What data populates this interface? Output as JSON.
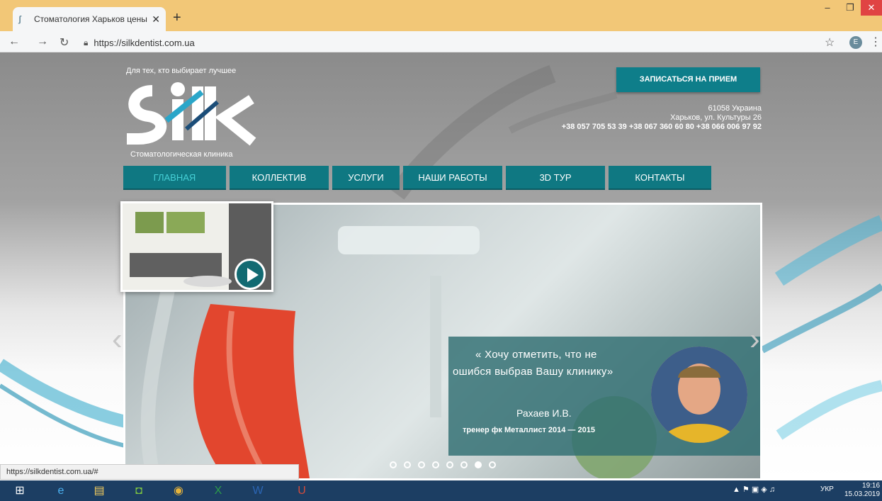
{
  "browser": {
    "tab_title": "Стоматология Харьков цены, ст",
    "url": "https://silkdentist.com.ua",
    "status_url": "https://silkdentist.com.ua/#",
    "profile_initial": "E"
  },
  "site": {
    "tagline": "Для тех, кто выбирает лучшее",
    "logo_text": "Silk",
    "logo_subtitle": "Стоматологическая клиника",
    "cta": "ЗАПИСАТЬСЯ НА ПРИЕМ",
    "address_line1": "61058 Украина",
    "address_line2": "Харьков, ул. Культуры 26",
    "phones": "+38 057 705 53 39 +38 067 360 60 80 +38 066 006 97 92",
    "nav": [
      "ГЛАВНАЯ",
      "КОЛЛЕКТИВ",
      "УСЛУГИ",
      "НАШИ РАБОТЫ",
      "3D ТУР",
      "КОНТАКТЫ"
    ],
    "nav_active": 0
  },
  "hero": {
    "quote": "« Хочу отметить, что не ошибся выбрав Вашу клинику»",
    "name": "Рахаев И.В.",
    "role": "тренер фк Металлист 2014 — 2015",
    "slides": 8,
    "active_slide": 6
  },
  "taskbar": {
    "lang": "УКР",
    "time": "19:16",
    "date": "15.03.2019"
  },
  "colors": {
    "accent": "#0f7882",
    "tab_bar": "#f2c777",
    "taskbar": "#1c3e63"
  }
}
